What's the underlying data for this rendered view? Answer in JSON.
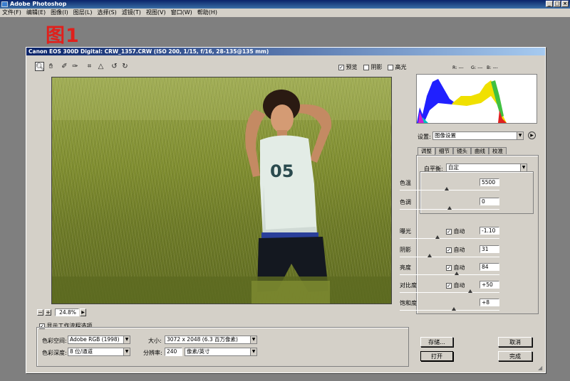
{
  "app": {
    "title": "Adobe Photoshop",
    "controls": [
      "_",
      "□",
      "×"
    ]
  },
  "menu": [
    "文件(F)",
    "编辑(E)",
    "图像(I)",
    "图层(L)",
    "选择(S)",
    "滤镜(T)",
    "视图(V)",
    "窗口(W)",
    "帮助(H)"
  ],
  "caption": "图1",
  "dialog": {
    "title": "Canon EOS 300D Digital: CRW_1357.CRW  (ISO 200, 1/15, f/16, 28-135@135 mm)",
    "toolbar": {
      "preview_label": "预览",
      "shadows_label": "阴影",
      "highlights_label": "高光",
      "preview_checked": true
    },
    "rgb_readout": {
      "r": "R: ---",
      "g": "G: ---",
      "b": "B: ---"
    },
    "zoom": {
      "value": "24.8%",
      "minus": "−",
      "plus": "+"
    },
    "settings": {
      "label": "设置:",
      "value": "图像设置"
    },
    "tabs": [
      "调整",
      "细节",
      "镜头",
      "曲线",
      "校准"
    ],
    "white_balance": {
      "label": "白平衡:",
      "value": "自定"
    },
    "sliders": [
      {
        "label": "色温",
        "value": "5500",
        "auto": false,
        "level": 0.47
      },
      {
        "label": "色调",
        "value": "0",
        "auto": false,
        "level": 0.5
      },
      {
        "label": "曝光",
        "value": "-1.10",
        "auto": true,
        "level": 0.38
      },
      {
        "label": "阴影",
        "value": "31",
        "auto": true,
        "level": 0.3
      },
      {
        "label": "亮度",
        "value": "84",
        "auto": true,
        "level": 0.57
      },
      {
        "label": "对比度",
        "value": "+50",
        "auto": true,
        "level": 0.71
      },
      {
        "label": "饱和度",
        "value": "+8",
        "auto": false,
        "level": 0.54
      }
    ],
    "auto_label": "自动",
    "workflow": {
      "toggle_label": "显示工作流程选项",
      "color_space_label": "色彩空间:",
      "color_space": "Adobe RGB (1998)",
      "depth_label": "色彩深度:",
      "depth": "8 位/通道",
      "size_label": "大小:",
      "size": "3072 x 2048  (6.3 百万像素)",
      "resolution_label": "分辨率:",
      "resolution": "240",
      "resolution_unit": "像素/英寸"
    },
    "buttons": {
      "save": "存储...",
      "cancel": "取消",
      "open": "打开",
      "done": "完成"
    }
  }
}
